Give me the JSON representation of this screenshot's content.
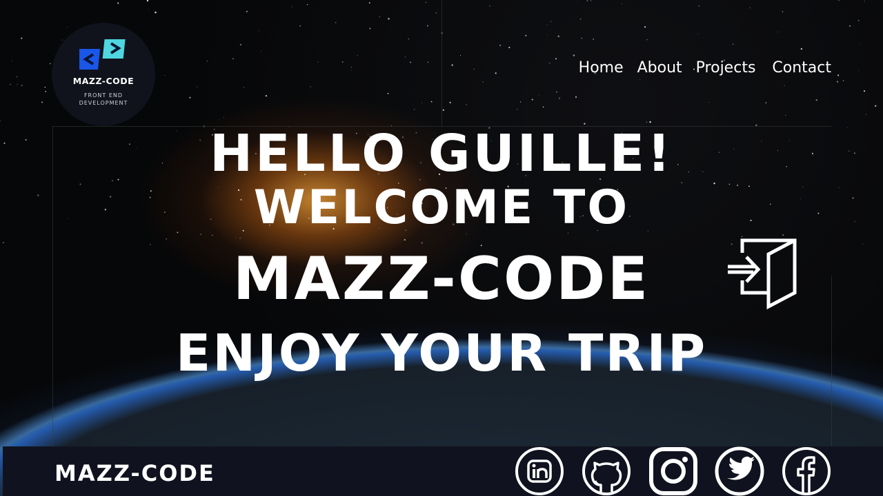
{
  "logo": {
    "title": "MAZZ-CODE",
    "subtitle_line1": "FRONT END",
    "subtitle_line2": "DEVELOPMENT",
    "colors": {
      "blue": "#1a56e8",
      "cyan": "#4fd6e0"
    }
  },
  "nav": {
    "items": [
      {
        "label": "Home"
      },
      {
        "label": "About"
      },
      {
        "label": "Projects"
      },
      {
        "label": "Contact"
      }
    ]
  },
  "hero": {
    "line1": "HELLO GUILLE!",
    "line2": "WELCOME TO",
    "line3": "MAZZ-CODE",
    "line4": "ENJOY YOUR TRIP"
  },
  "enter_button": {
    "icon": "enter-door-icon"
  },
  "footer": {
    "brand": "MAZZ-CODE",
    "social": [
      {
        "icon": "linkedin-icon"
      },
      {
        "icon": "github-icon"
      },
      {
        "icon": "instagram-icon"
      },
      {
        "icon": "twitter-icon"
      },
      {
        "icon": "facebook-icon"
      }
    ]
  }
}
